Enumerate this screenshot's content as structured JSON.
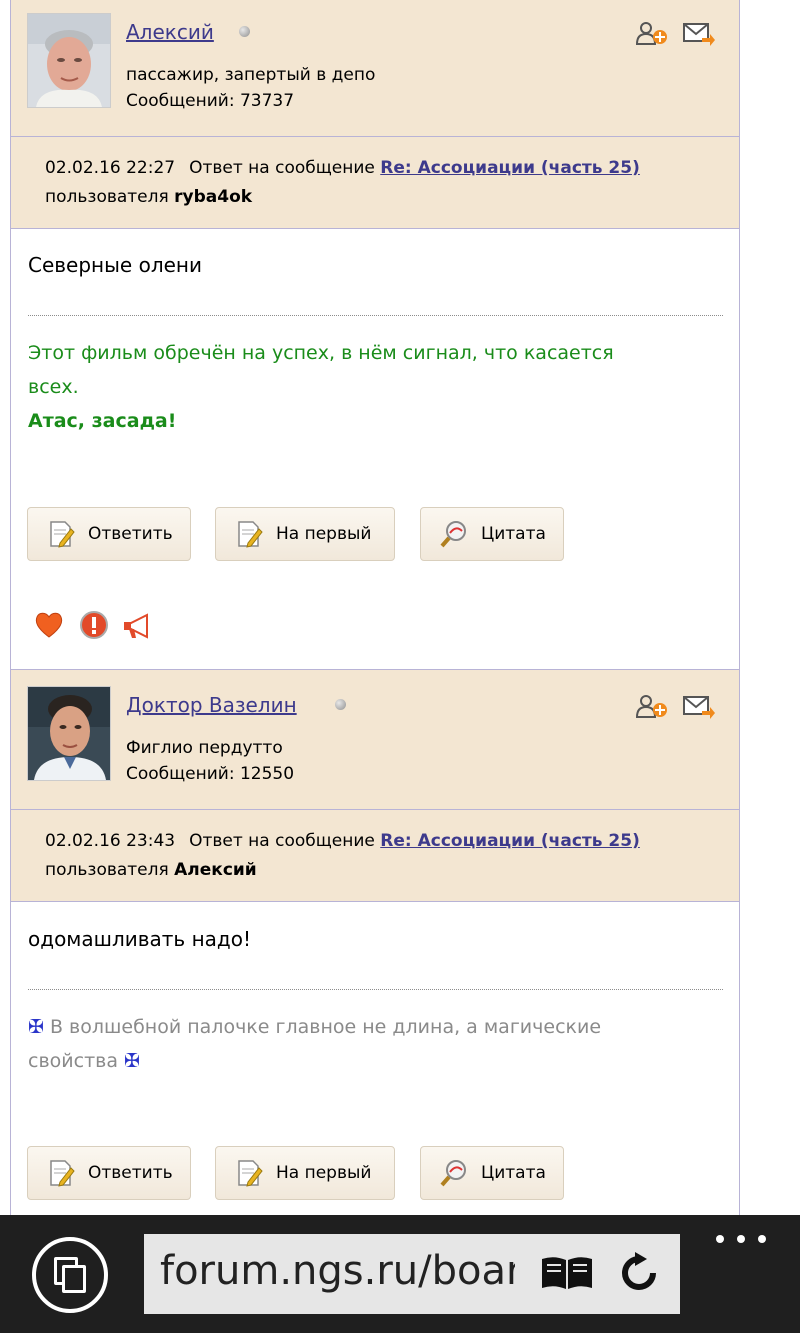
{
  "posts": [
    {
      "author": "Алексий",
      "user_title": "пассажир, запертый в депо",
      "count_label": "Сообщений:",
      "count": "73737",
      "datetime": "02.02.16 22:27",
      "reply_prefix": "Ответ на сообщение",
      "reply_link": "Re: Ассоциации (часть 25)",
      "reply_user_prefix": "пользователя",
      "reply_user": "ryba4ok",
      "text": "Северные олени",
      "signature": {
        "line1": "Этот фильм обречён на успех, в нём сигнал, что касается",
        "line2": "всех.",
        "bold": "Атас, засада!"
      }
    },
    {
      "author": "Доктор  Вазелин",
      "user_title": "Фиглио пердутто",
      "count_label": "Сообщений:",
      "count": "12550",
      "datetime": "02.02.16 23:43",
      "reply_prefix": "Ответ на сообщение",
      "reply_link": "Re: Ассоциации (часть 25)",
      "reply_user_prefix": "пользователя",
      "reply_user": "Алексий",
      "text": "одомашливать надо!",
      "signature": {
        "cross": "✠",
        "line1": "В волшебной палочке главное не длина, а магические",
        "line2": "свойства"
      }
    }
  ],
  "buttons": {
    "reply": "Ответить",
    "first": "На первый",
    "quote": "Цитата"
  },
  "browser": {
    "url": "forum.ngs.ru/boarc"
  },
  "icons": {
    "add_friend": "add-friend-icon",
    "message": "envelope-arrow-icon",
    "like": "heart-icon",
    "report": "warning-icon",
    "announce": "megaphone-icon",
    "reply": "note-pencil-icon",
    "quote": "magnifier-icon",
    "tabs": "tabs-icon",
    "reader": "book-icon",
    "refresh": "refresh-icon",
    "more": "more-dots-icon"
  },
  "colors": {
    "header_bg": "#f3e6d2",
    "link": "#3d3a8c",
    "signature_green": "#1a8c1a",
    "signature_grey": "#8a8a8a",
    "border": "#b8b3d6"
  }
}
